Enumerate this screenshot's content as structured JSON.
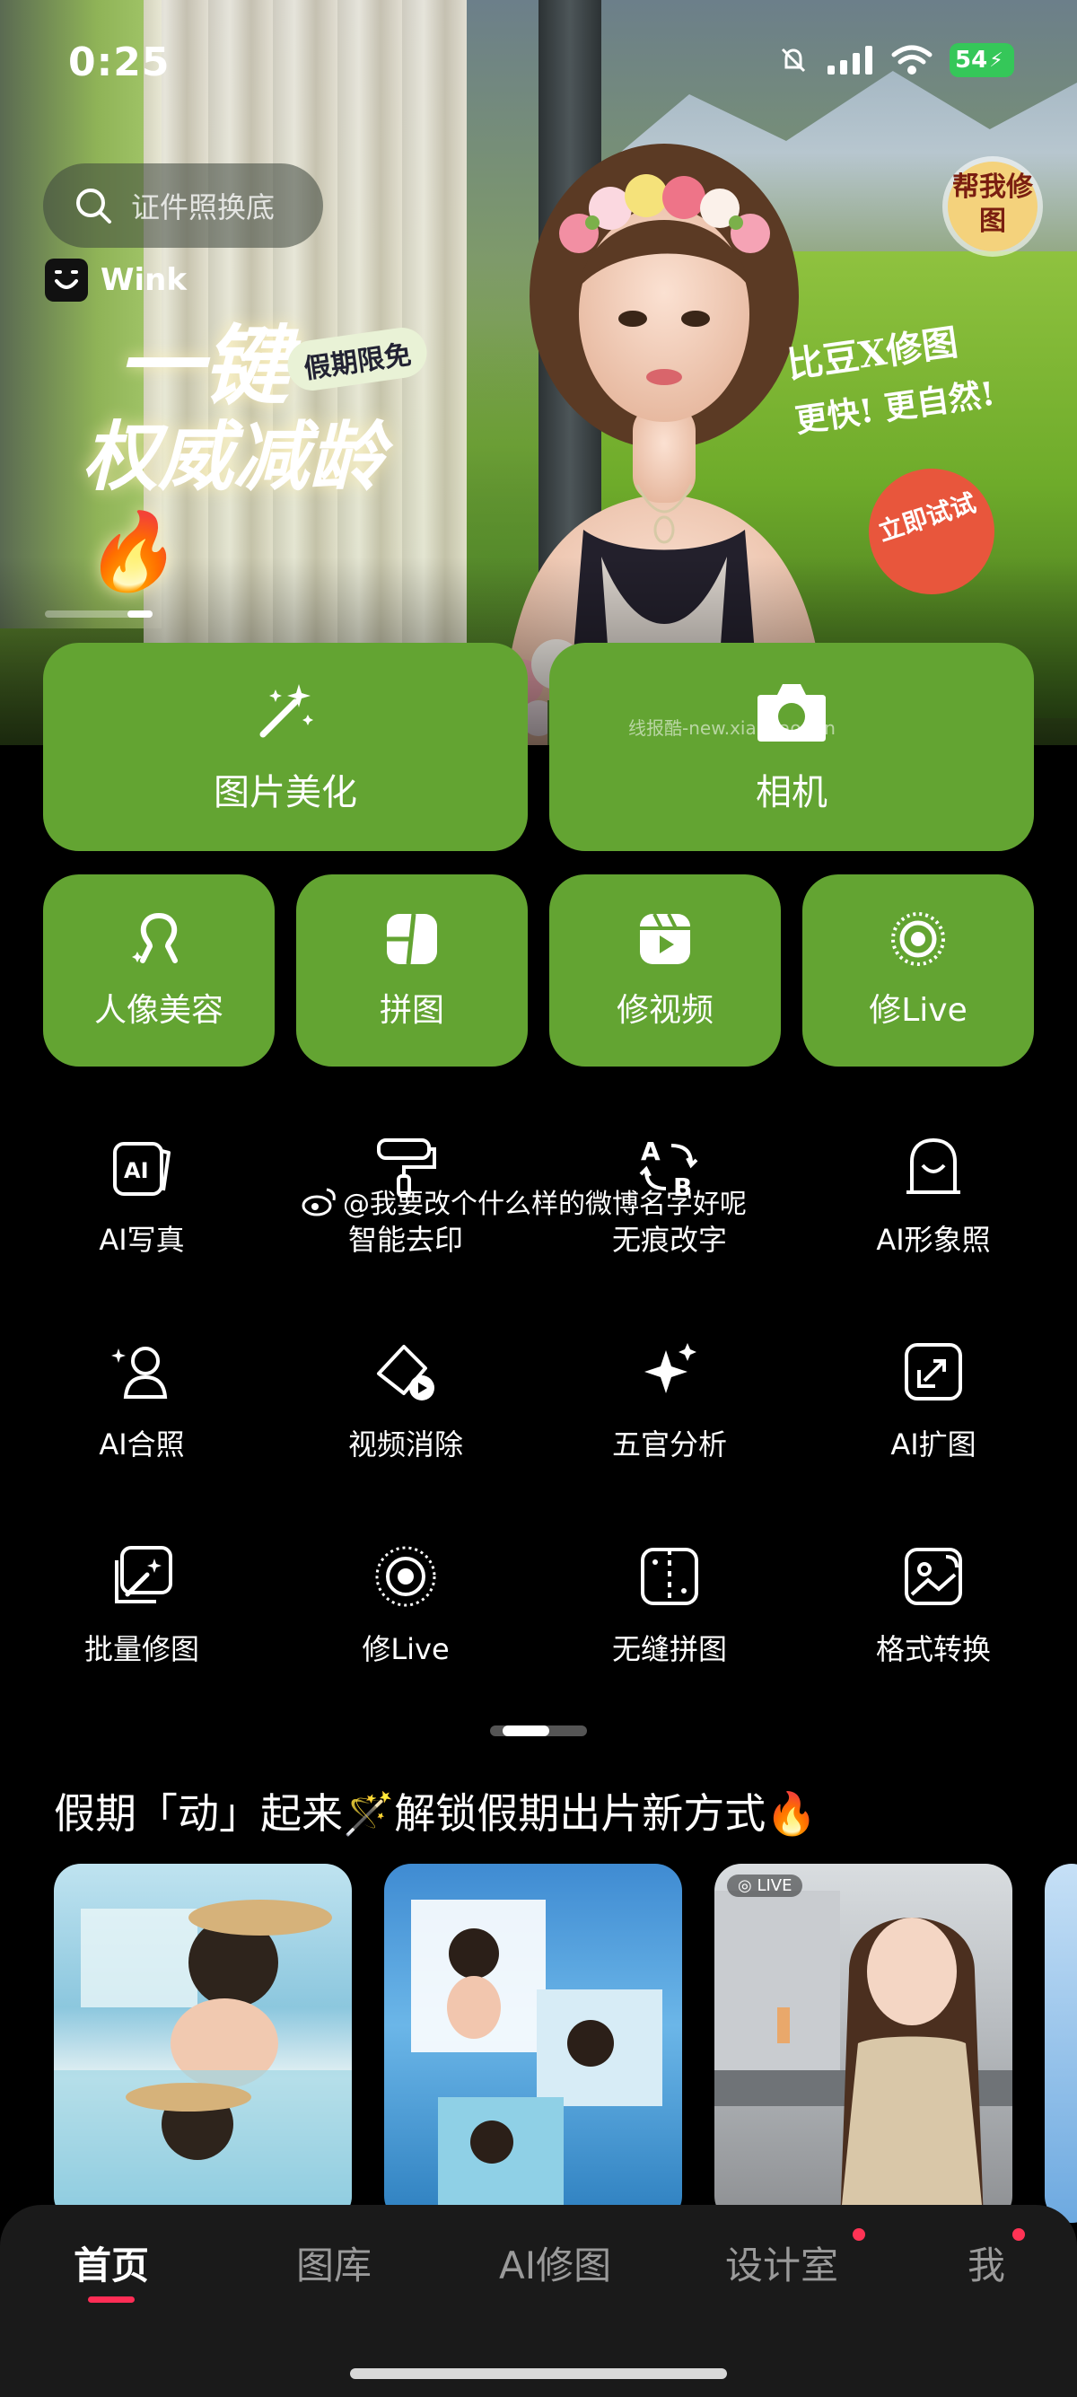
{
  "status_bar": {
    "time": "0:25",
    "battery": "54"
  },
  "hero": {
    "search_placeholder": "证件照换底",
    "brand_name": "Wink",
    "headline_line1": "一键",
    "headline_line2": "权威减龄🔥",
    "badge": "假期限免",
    "slogan_line1": "比豆X修图",
    "slogan_line2": "更快! 更自然!",
    "help_badge": "帮我修图",
    "try_button": "立即试试",
    "watermark": "线报酷-new.xianbao.fun"
  },
  "primary_tools": [
    {
      "label": "图片美化",
      "icon": "magic-wand-icon"
    },
    {
      "label": "相机",
      "icon": "camera-icon"
    }
  ],
  "secondary_tools": [
    {
      "label": "人像美容",
      "icon": "portrait-icon"
    },
    {
      "label": "拼图",
      "icon": "collage-icon"
    },
    {
      "label": "修视频",
      "icon": "video-edit-icon"
    },
    {
      "label": "修Live",
      "icon": "live-icon"
    }
  ],
  "tool_grid": [
    {
      "label": "AI写真",
      "icon": "ai-photo-icon"
    },
    {
      "label": "智能去印",
      "icon": "paint-roller-icon"
    },
    {
      "label": "无痕改字",
      "icon": "text-swap-icon"
    },
    {
      "label": "AI形象照",
      "icon": "avatar-icon"
    },
    {
      "label": "AI合照",
      "icon": "group-photo-icon"
    },
    {
      "label": "视频消除",
      "icon": "eraser-video-icon"
    },
    {
      "label": "五官分析",
      "icon": "sparkle-icon"
    },
    {
      "label": "AI扩图",
      "icon": "expand-icon"
    },
    {
      "label": "批量修图",
      "icon": "batch-edit-icon"
    },
    {
      "label": "修Live",
      "icon": "live-icon"
    },
    {
      "label": "无缝拼图",
      "icon": "seamless-collage-icon"
    },
    {
      "label": "格式转换",
      "icon": "format-convert-icon"
    }
  ],
  "weibo_watermark": "@我要改个什么样的微博名字好呢",
  "section": {
    "title": "假期「动」起来🪄解锁假期出片新方式🔥"
  },
  "cards": [
    {
      "tag": ""
    },
    {
      "tag": ""
    },
    {
      "tag": "LIVE"
    }
  ],
  "bottom_nav": {
    "tabs": [
      {
        "label": "首页",
        "active": true
      },
      {
        "label": "图库",
        "active": false
      },
      {
        "label": "AI修图",
        "active": false
      },
      {
        "label": "设计室",
        "active": false,
        "dot": true
      },
      {
        "label": "我",
        "active": false,
        "dot": true
      }
    ]
  },
  "colors": {
    "tile_green": "#63a432",
    "accent_red": "#ff2d55",
    "background": "#000000"
  }
}
